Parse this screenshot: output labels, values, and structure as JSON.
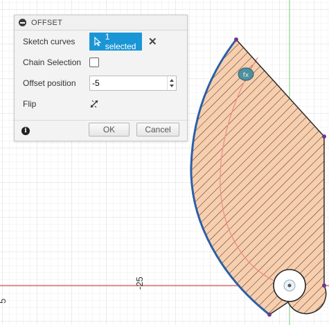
{
  "dialog": {
    "title": "OFFSET",
    "sketch_curves_label": "Sketch curves",
    "selection_text": "1 selected",
    "clear_symbol": "✕",
    "chain_selection_label": "Chain Selection",
    "chain_selection_checked": false,
    "offset_position_label": "Offset position",
    "offset_position_value": "-5",
    "flip_label": "Flip",
    "ok_label": "OK",
    "cancel_label": "Cancel",
    "info_symbol": "i"
  },
  "canvas": {
    "axis_tick_label": "-25",
    "axis_tick_label_left": "5",
    "selection_color": "#1a96d6",
    "fill_color": "#f7cfae",
    "profile_color": "#2b5fa8",
    "construction_color": "#f08c8c",
    "axis_color": "#e05050",
    "grid_color": "#e4e4e4"
  }
}
